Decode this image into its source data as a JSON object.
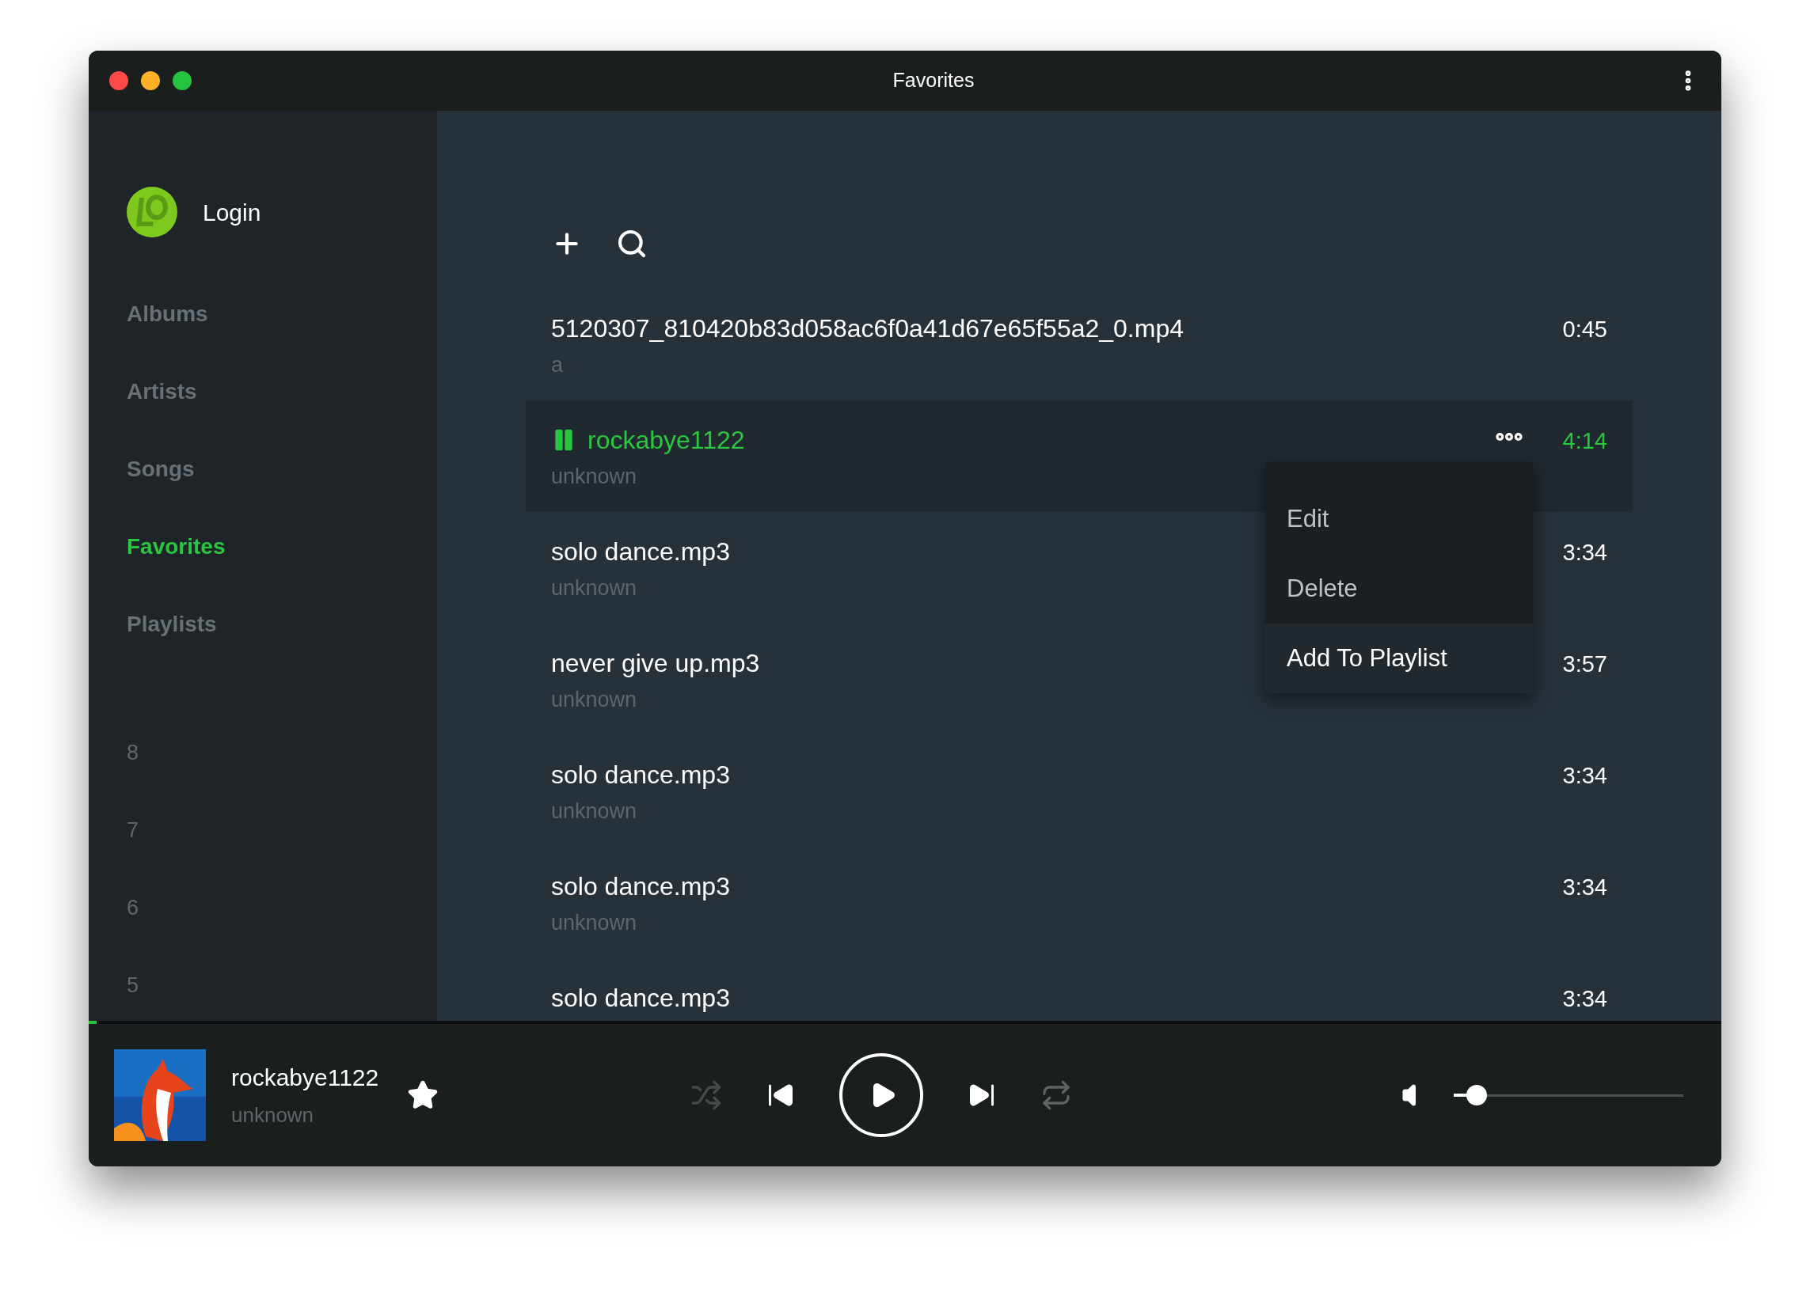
{
  "window": {
    "title": "Favorites"
  },
  "sidebar": {
    "user": {
      "name": "Login"
    },
    "nav": [
      {
        "label": "Albums",
        "selected": false
      },
      {
        "label": "Artists",
        "selected": false
      },
      {
        "label": "Songs",
        "selected": false
      },
      {
        "label": "Favorites",
        "selected": true
      },
      {
        "label": "Playlists",
        "selected": false
      }
    ],
    "numbered_items": [
      "8",
      "7",
      "6",
      "5"
    ]
  },
  "songs": [
    {
      "title": "5120307_810420b83d058ac6f0a41d67e65f55a2_0.mp4",
      "artist": "a",
      "duration": "0:45",
      "playing": false
    },
    {
      "title": "rockabye1122",
      "artist": "unknown",
      "duration": "4:14",
      "playing": true
    },
    {
      "title": "solo dance.mp3",
      "artist": "unknown",
      "duration": "3:34",
      "playing": false
    },
    {
      "title": "never give up.mp3",
      "artist": "unknown",
      "duration": "3:57",
      "playing": false
    },
    {
      "title": "solo dance.mp3",
      "artist": "unknown",
      "duration": "3:34",
      "playing": false
    },
    {
      "title": "solo dance.mp3",
      "artist": "unknown",
      "duration": "3:34",
      "playing": false
    },
    {
      "title": "solo dance.mp3",
      "duration": "3:34",
      "playing": false
    }
  ],
  "context_menu": {
    "items": [
      {
        "label": "Edit",
        "selected": false
      },
      {
        "label": "Delete",
        "selected": false
      },
      {
        "label": "Add To Playlist",
        "selected": true
      }
    ]
  },
  "player": {
    "title": "rockabye1122",
    "artist": "unknown",
    "favorite": true,
    "progress": {
      "level": 0.005
    },
    "shuffle": false,
    "repeat": false,
    "playing": false,
    "volume": {
      "level": 0.1
    }
  }
}
